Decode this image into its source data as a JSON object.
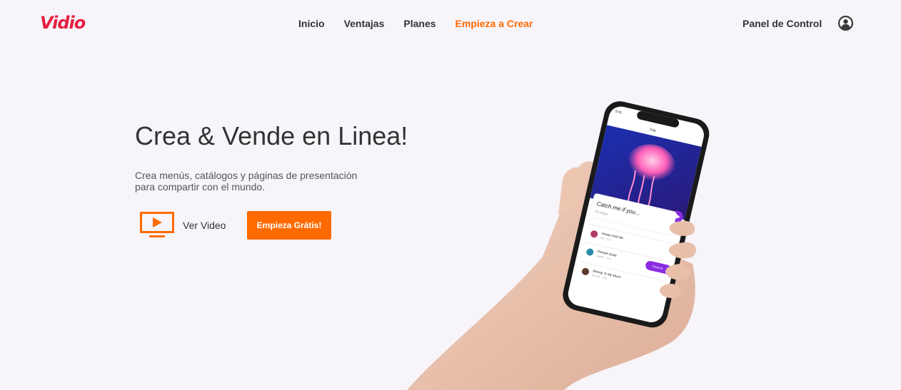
{
  "header": {
    "logo": "Vidio",
    "nav": [
      {
        "label": "Inicio"
      },
      {
        "label": "Ventajas"
      },
      {
        "label": "Planes"
      },
      {
        "label": "Empieza a Crear",
        "active": true
      }
    ],
    "panel_label": "Panel de Control",
    "avatar_icon": "user-circle-icon"
  },
  "hero": {
    "title": "Crea & Vende en Linea!",
    "subtitle_line1": "Crea menús, catálogos y páginas de presentación",
    "subtitle_line2": "para compartir con el mundo.",
    "video_label": "Ver Video",
    "video_icon": "play-screen-icon",
    "cta_label": "Empieza Grátis!"
  },
  "phone_app": {
    "time": "9:41",
    "screen_title": "Tide",
    "card_title": "Catch me if you...",
    "card_subtitle": "22 songs",
    "tracks": [
      {
        "title": "Honey Hold Me",
        "artist": "Nej · 3:24"
      },
      {
        "title": "Female Smile",
        "artist": "Agatha · 2:31",
        "button": "Remove"
      },
      {
        "title": "Belong To My Music",
        "artist": "Brenda · 3:05"
      }
    ]
  },
  "colors": {
    "brand": "#e51e3f",
    "accent": "#ff6a00",
    "background": "#f7f4fa",
    "app_purple": "#8a2be2"
  }
}
